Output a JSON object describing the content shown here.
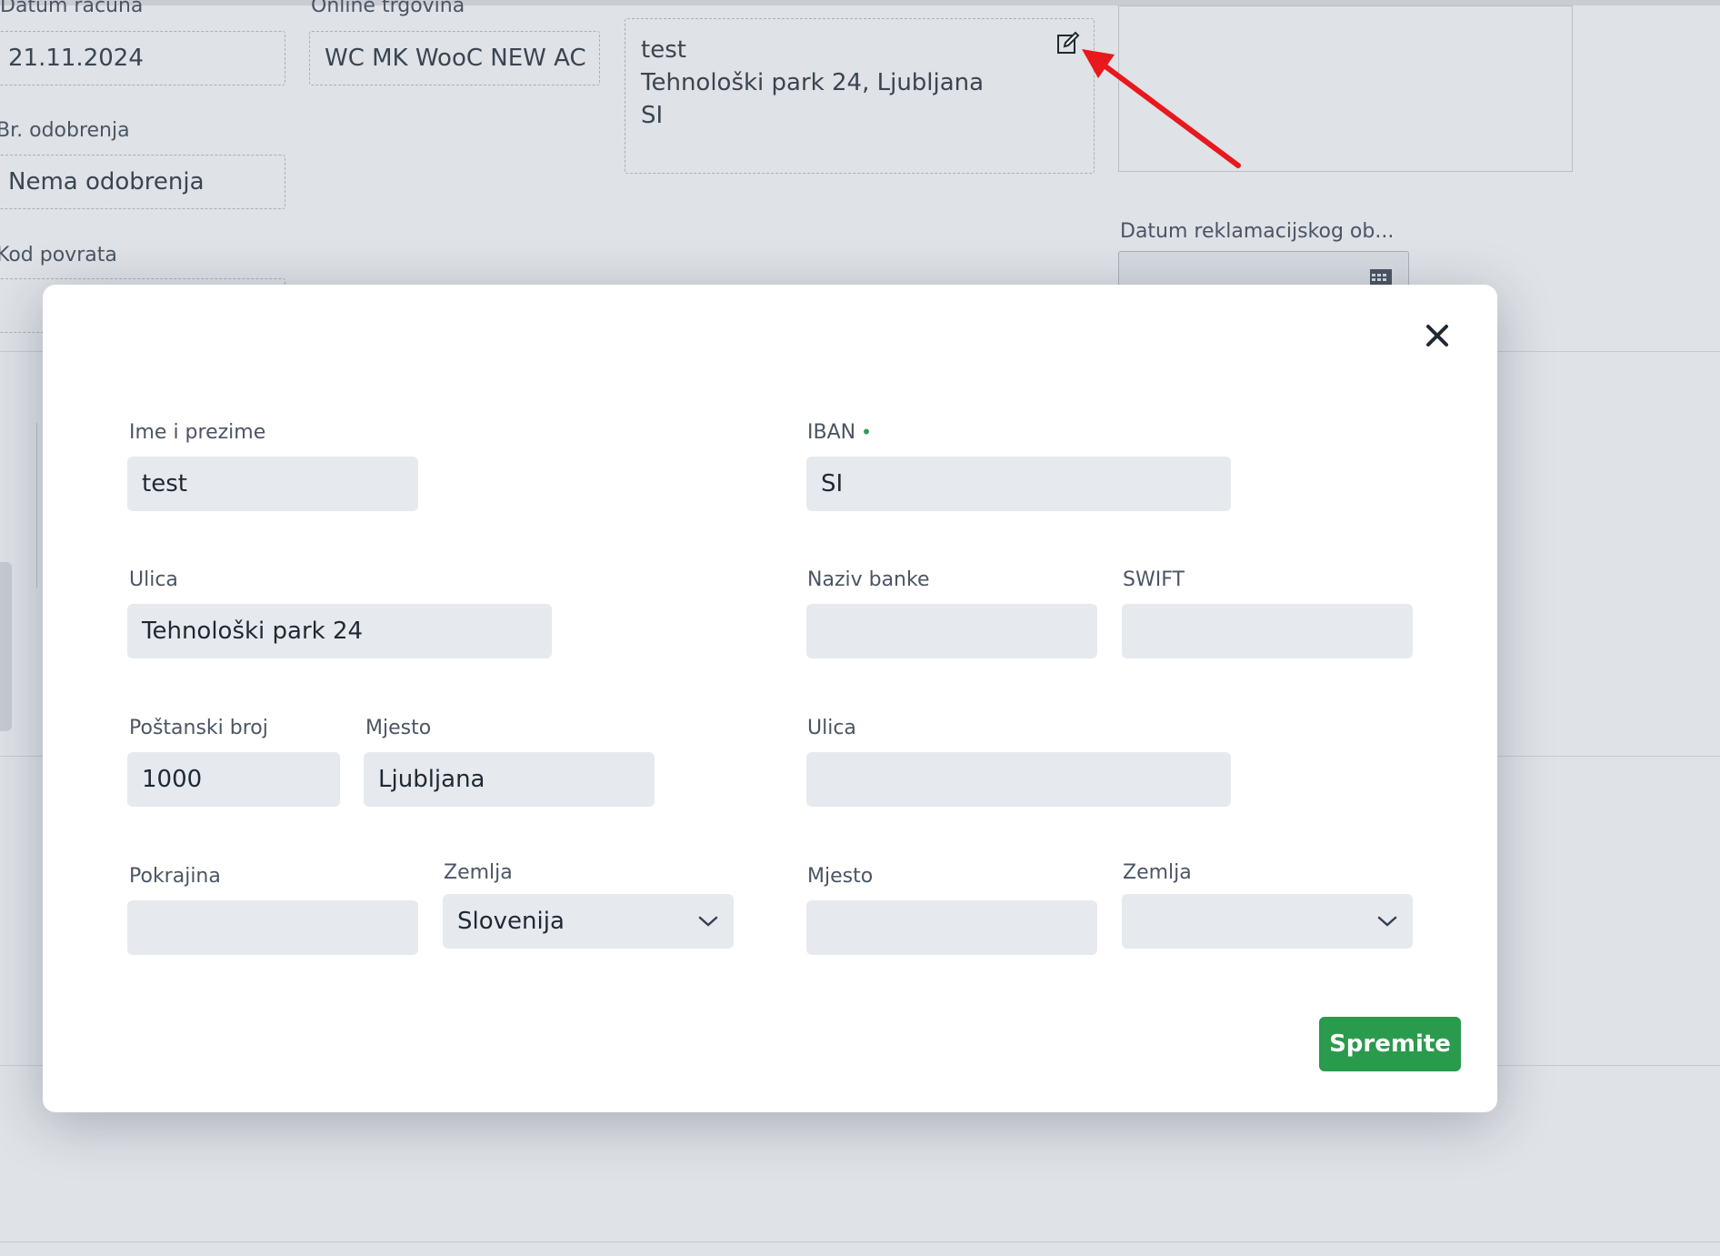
{
  "background": {
    "labels": {
      "datum_racuna": "Datum računa",
      "online_trgovina": "Online trgovina",
      "br_odobrenja": "Br. odobrenja",
      "kod_povrata": "Kod povrata",
      "datum_reklamacijskog": "Datum reklamacijskog ob..."
    },
    "values": {
      "datum_racuna": "21.11.2024",
      "online_trgovina": "WC MK WooC NEW AC",
      "br_odobrenja": "Nema odobrenja"
    },
    "address_box": {
      "line1": "test",
      "line2": "Tehnološki park 24, Ljubljana",
      "line3": "SI"
    }
  },
  "modal": {
    "left": {
      "ime_label": "Ime i prezime",
      "ime_value": "test",
      "ulica_label": "Ulica",
      "ulica_value": "Tehnološki park 24",
      "postanski_label": "Poštanski broj",
      "postanski_value": "1000",
      "mjesto_label": "Mjesto",
      "mjesto_value": "Ljubljana",
      "pokrajina_label": "Pokrajina",
      "pokrajina_value": "",
      "zemlja_label": "Zemlja",
      "zemlja_value": "Slovenija"
    },
    "right": {
      "iban_label": "IBAN",
      "iban_value": "SI",
      "naziv_banke_label": "Naziv banke",
      "naziv_banke_value": "",
      "swift_label": "SWIFT",
      "swift_value": "",
      "ulica_label": "Ulica",
      "ulica_value": "",
      "mjesto_label": "Mjesto",
      "mjesto_value": "",
      "zemlja_label": "Zemlja",
      "zemlja_value": ""
    },
    "save_label": "Spremite",
    "icons": {
      "close": "close-icon",
      "select": "chevron-down-icon",
      "edit": "edit-icon"
    },
    "colors": {
      "save": "#2a9a4c",
      "required_dot": "#2e9d57",
      "arrow": "#e8181d"
    }
  }
}
